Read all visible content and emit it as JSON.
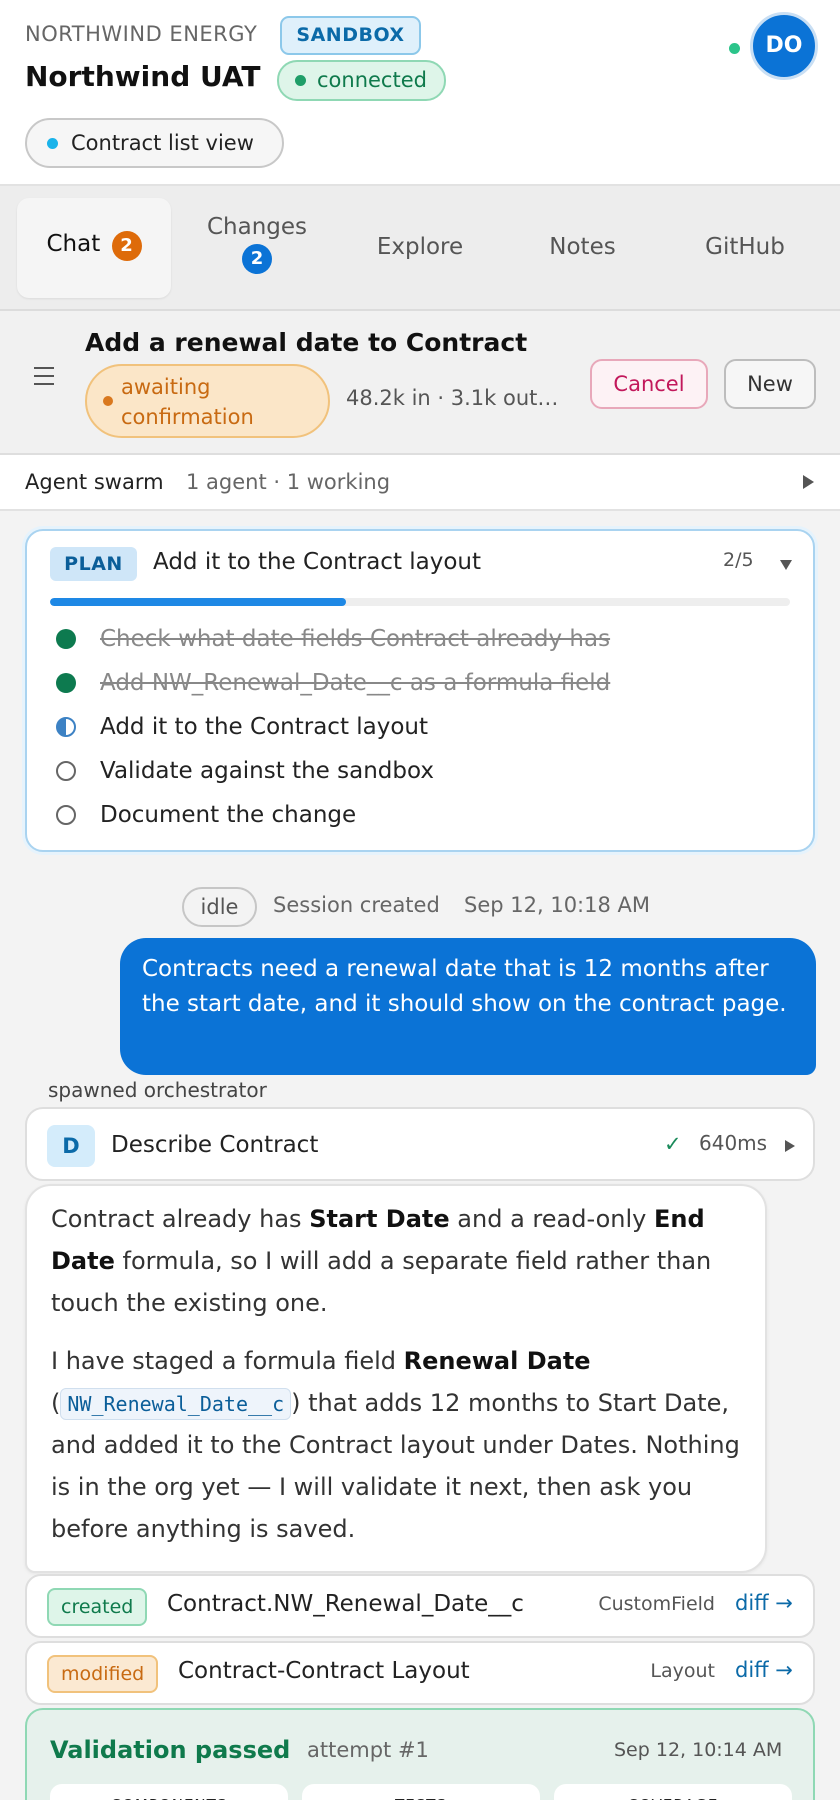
{
  "header": {
    "org_name": "NORTHWIND ENERGY",
    "env_badge": "SANDBOX",
    "env_title": "Northwind UAT",
    "connection_status": "connected",
    "view_chip": "Contract list view",
    "avatar_initials": "DO",
    "online_color": "#2bc48a"
  },
  "tabs": [
    {
      "label": "Chat",
      "badge": "2",
      "active": true,
      "badge_color": "#de6b0a"
    },
    {
      "label": "Changes",
      "badge": "2",
      "active": false,
      "badge_color": "#0b73d6"
    },
    {
      "label": "Explore"
    },
    {
      "label": "Notes"
    },
    {
      "label": "GitHub"
    }
  ],
  "session": {
    "title": "Add a renewal date to Contract",
    "status": "awaiting confirmation",
    "tokens": "48.2k in · 3.1k out…",
    "cancel_label": "Cancel",
    "new_label": "New"
  },
  "swarm": {
    "label": "Agent swarm",
    "status": "1 agent · 1 working"
  },
  "plan": {
    "badge": "PLAN",
    "current_step": "Add it to the Contract layout",
    "count": "2/5",
    "progress_fraction": 0.4,
    "steps": [
      {
        "text": "Check what date fields Contract already has",
        "state": "done"
      },
      {
        "text": "Add NW_Renewal_Date__c as a formula field",
        "state": "done"
      },
      {
        "text": "Add it to the Contract layout",
        "state": "active"
      },
      {
        "text": "Validate against the sandbox",
        "state": "todo"
      },
      {
        "text": "Document the change",
        "state": "todo"
      }
    ]
  },
  "timeline": {
    "idle_label": "idle",
    "session_created": "Session created",
    "session_time": "Sep 12, 10:18 AM",
    "user_message": "Contracts need a renewal date that is 12 months after the start date, and it should show on the contract page.",
    "spawned_label": "spawned orchestrator",
    "tool_call": {
      "avatar": "D",
      "name": "Describe Contract",
      "duration": "640ms"
    },
    "agent_message": {
      "p1_a": "Contract already has ",
      "p1_b": "Start Date",
      "p1_c": " and a read-only ",
      "p1_d": "End Date",
      "p1_e": " formula, so I will add a separate field rather than touch the existing one.",
      "p2_a": "I have staged a formula field ",
      "p2_b": "Renewal Date",
      "p2_c": "(",
      "p2_code": "NW_Renewal_Date__c",
      "p2_d": ") that adds 12 months to Start Date, and added it to the Contract layout under Dates. Nothing is in the org yet — I will validate it next, then ask you before anything is saved."
    },
    "changes": [
      {
        "badge": "created",
        "name": "Contract.NW_Renewal_Date__c",
        "type": "CustomField",
        "diff": "diff →"
      },
      {
        "badge": "modified",
        "name": "Contract-Contract Layout",
        "type": "Layout",
        "diff": "diff →"
      }
    ],
    "validation": {
      "title": "Validation passed",
      "attempt": "attempt #1",
      "time": "Sep 12, 10:14 AM",
      "stats": [
        "COMPONENTS",
        "TESTS",
        "COVERAGE"
      ]
    }
  }
}
